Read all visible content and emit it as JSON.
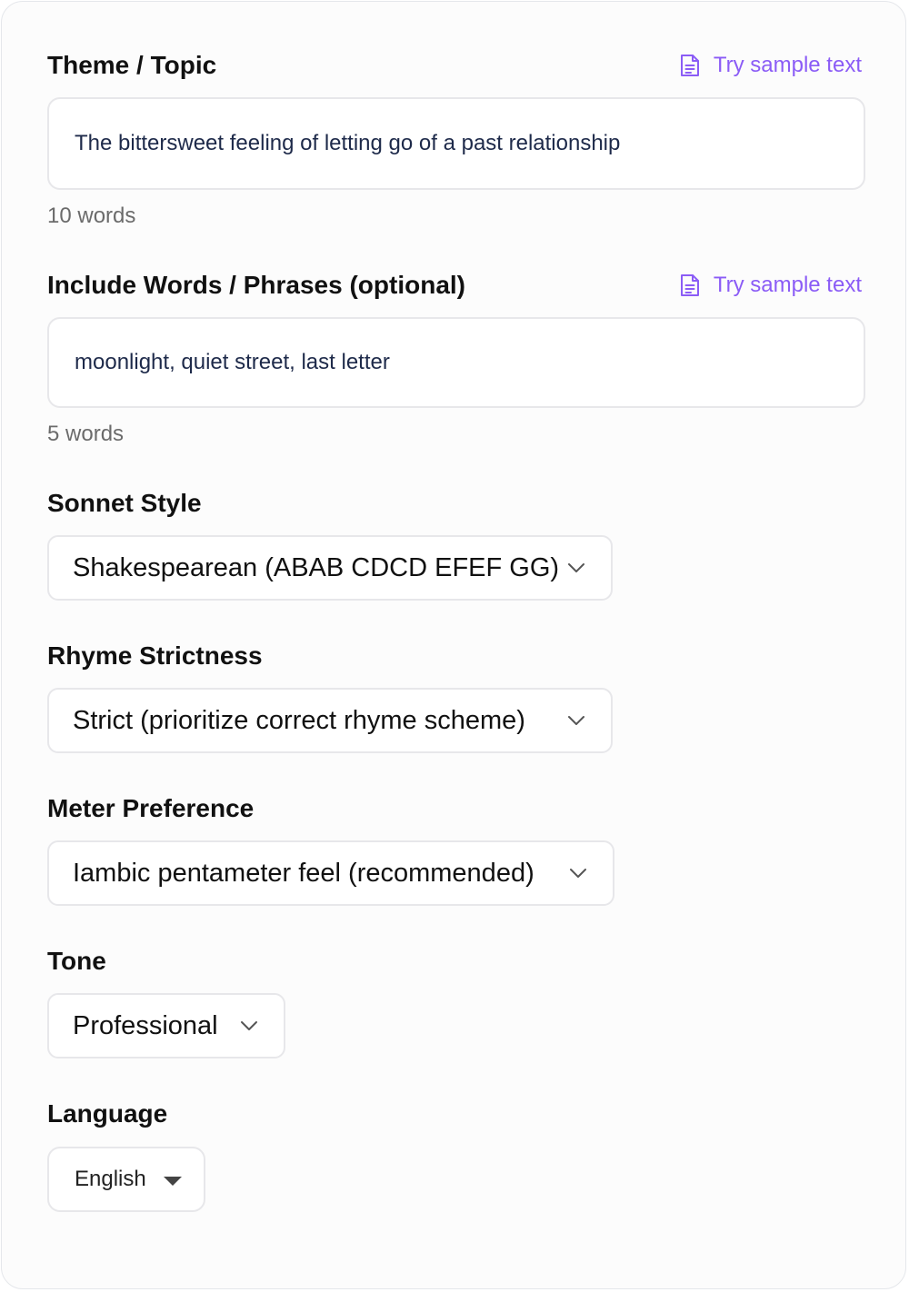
{
  "colors": {
    "accent": "#8b5cf6",
    "input_text": "#1e2a4a",
    "muted": "#6b6b6b",
    "border": "#e7e7ea"
  },
  "theme": {
    "label": "Theme / Topic",
    "sample_link": "Try sample text",
    "sample_icon": "document-icon",
    "value": "The bittersweet feeling of letting go of a past relationship",
    "word_count": "10 words"
  },
  "include_words": {
    "label": "Include Words / Phrases (optional)",
    "sample_link": "Try sample text",
    "sample_icon": "document-icon",
    "value": "moonlight, quiet street, last letter",
    "word_count": "5 words"
  },
  "sonnet_style": {
    "label": "Sonnet Style",
    "selected": "Shakespearean (ABAB CDCD EFEF GG)"
  },
  "rhyme_strictness": {
    "label": "Rhyme Strictness",
    "selected": "Strict (prioritize correct rhyme scheme)"
  },
  "meter_preference": {
    "label": "Meter Preference",
    "selected": "Iambic pentameter feel (recommended)"
  },
  "tone": {
    "label": "Tone",
    "selected": "Professional"
  },
  "language": {
    "label": "Language",
    "selected": "English"
  }
}
